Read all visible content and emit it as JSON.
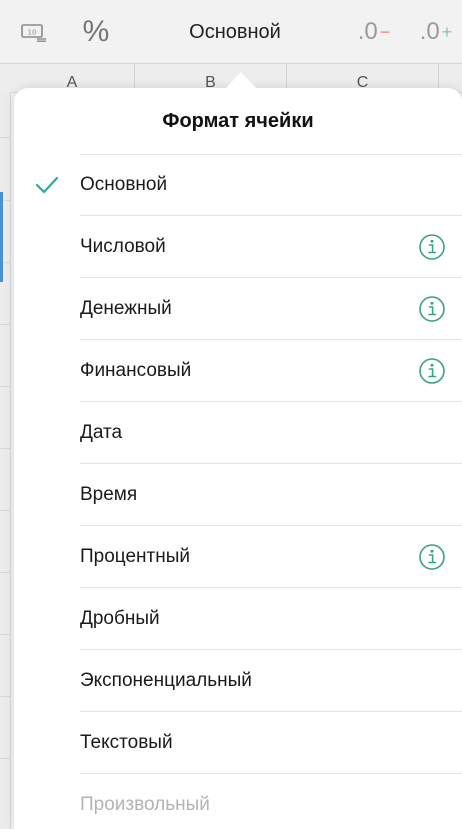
{
  "toolbar": {
    "currency_icon": "currency-format-icon",
    "percent_label": "%",
    "format_label": "Основной",
    "decrease_decimal_label": ".0",
    "decrease_decimal_sign": "−",
    "increase_decimal_label": ".0",
    "increase_decimal_sign": "+"
  },
  "columns": [
    "A",
    "B",
    "C"
  ],
  "popover": {
    "title": "Формат ячейки",
    "items": [
      {
        "label": "Основной",
        "selected": true,
        "info": false,
        "enabled": true
      },
      {
        "label": "Числовой",
        "selected": false,
        "info": true,
        "enabled": true
      },
      {
        "label": "Денежный",
        "selected": false,
        "info": true,
        "enabled": true
      },
      {
        "label": "Финансовый",
        "selected": false,
        "info": true,
        "enabled": true
      },
      {
        "label": "Дата",
        "selected": false,
        "info": false,
        "enabled": true
      },
      {
        "label": "Время",
        "selected": false,
        "info": false,
        "enabled": true
      },
      {
        "label": "Процентный",
        "selected": false,
        "info": true,
        "enabled": true
      },
      {
        "label": "Дробный",
        "selected": false,
        "info": false,
        "enabled": true
      },
      {
        "label": "Экспоненциальный",
        "selected": false,
        "info": false,
        "enabled": true
      },
      {
        "label": "Текстовый",
        "selected": false,
        "info": false,
        "enabled": true
      },
      {
        "label": "Произвольный",
        "selected": false,
        "info": false,
        "enabled": false
      }
    ]
  },
  "colors": {
    "accent": "#2eaa9a",
    "info_icon": "#3aa37f",
    "disabled_text": "#b3b3b3"
  }
}
